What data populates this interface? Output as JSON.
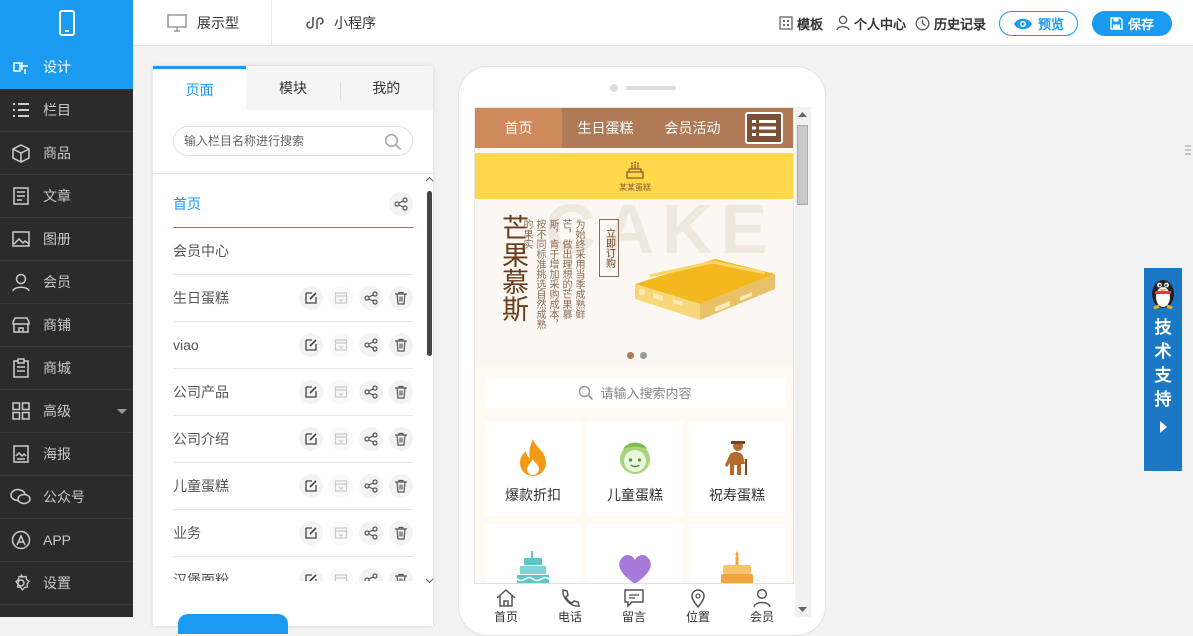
{
  "sidebar": {
    "items": [
      {
        "label": "设计",
        "icon": "design-icon",
        "active": true
      },
      {
        "label": "栏目",
        "icon": "list-icon"
      },
      {
        "label": "商品",
        "icon": "box-icon"
      },
      {
        "label": "文章",
        "icon": "article-icon"
      },
      {
        "label": "图册",
        "icon": "image-icon"
      },
      {
        "label": "会员",
        "icon": "user-icon"
      },
      {
        "label": "商铺",
        "icon": "shop-icon"
      },
      {
        "label": "商城",
        "icon": "mall-icon"
      },
      {
        "label": "高级",
        "icon": "grid-icon"
      },
      {
        "label": "海报",
        "icon": "poster-icon"
      },
      {
        "label": "公众号",
        "icon": "wechat-icon"
      },
      {
        "label": "APP",
        "icon": "app-icon"
      },
      {
        "label": "设置",
        "icon": "gear-icon"
      }
    ]
  },
  "topbar": {
    "tab_display": "展示型",
    "tab_miniprogram": "小程序",
    "template": "模板",
    "personal": "个人中心",
    "history": "历史记录",
    "preview": "预览",
    "save": "保存"
  },
  "panel": {
    "tabs": [
      "页面",
      "模块",
      "我的"
    ],
    "search_placeholder": "输入栏目名称进行搜索",
    "pages": [
      "首页",
      "会员中心",
      "生日蛋糕",
      "viao",
      "公司产品",
      "公司介绍",
      "儿童蛋糕",
      "业务",
      "汉堡面粉"
    ]
  },
  "mobile": {
    "nav": [
      "首页",
      "生日蛋糕",
      "会员活动"
    ],
    "brand": "某某蛋糕",
    "watermark": "CAKE",
    "hero_title": "芒果慕斯",
    "hero_desc": "为始终采用当季成熟鲜芒，做出理想的芒果慕斯，肯于增加采购成本，按不同标准挑选自然成熟的果实",
    "hero_button": "立即订购",
    "search_placeholder": "请输入搜索内容",
    "grid": [
      {
        "label": "爆款折扣",
        "icon": "flame-icon"
      },
      {
        "label": "儿童蛋糕",
        "icon": "child-icon"
      },
      {
        "label": "祝寿蛋糕",
        "icon": "elder-icon"
      },
      {
        "label": "",
        "icon": "layer-cake-icon"
      },
      {
        "label": "",
        "icon": "heart-icon"
      },
      {
        "label": "",
        "icon": "candle-cake-icon"
      }
    ],
    "footer": [
      "首页",
      "电话",
      "留言",
      "位置",
      "会员"
    ]
  },
  "tech_support": "技术支持",
  "colors": {
    "accent": "#1a9af0",
    "sidebar": "#2b2b2b",
    "nav_brown": "#b07a56",
    "banner_yellow": "#ffd84a"
  }
}
